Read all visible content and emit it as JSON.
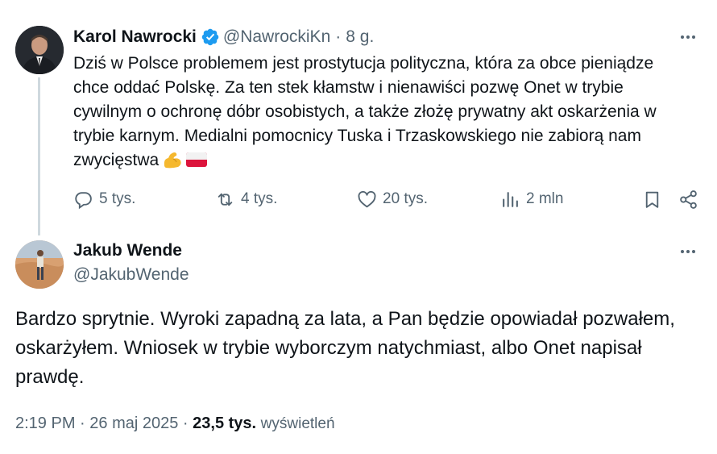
{
  "tweet1": {
    "author_name": "Karol Nawrocki",
    "handle": "@NawrockiKn",
    "separator": "·",
    "time_ago": "8 g.",
    "text": "Dziś w Polsce problemem jest prostytucja polityczna, która za obce pieniądze chce oddać Polskę. Za ten stek kłamstw i nienawiści pozwę Onet w trybie cywilnym o ochronę dóbr osobistych, a także złożę prywatny akt oskarżenia w trybie karnym. Medialni pomocnicy Tuska i Trzaskowskiego nie zabiorą nam zwycięstwa",
    "emojis": [
      "flexed-biceps-emoji",
      "poland-flag-emoji"
    ],
    "actions": {
      "replies": "5 tys.",
      "reposts": "4 tys.",
      "likes": "20 tys.",
      "views": "2 mln"
    },
    "icons": [
      "reply-icon",
      "repost-icon",
      "like-icon",
      "views-icon",
      "bookmark-icon",
      "share-icon",
      "verified-badge-icon",
      "more-options-icon"
    ]
  },
  "tweet2": {
    "author_name": "Jakub Wende",
    "handle": "@JakubWende",
    "text": "Bardzo sprytnie. Wyroki zapadną za lata, a Pan będzie opowiadał pozwałem, oskarżyłem. Wniosek w trybie wyborczym natychmiast, albo Onet napisał prawdę.",
    "time": "2:19 PM",
    "separator": "·",
    "date": "26 maj 2025",
    "views_count": "23,5 tys.",
    "views_label": "wyświetleń"
  },
  "colors": {
    "text_primary": "#0f1419",
    "text_secondary": "#536471",
    "verified_blue": "#1d9bf0",
    "thread_line": "#cfd9de"
  }
}
